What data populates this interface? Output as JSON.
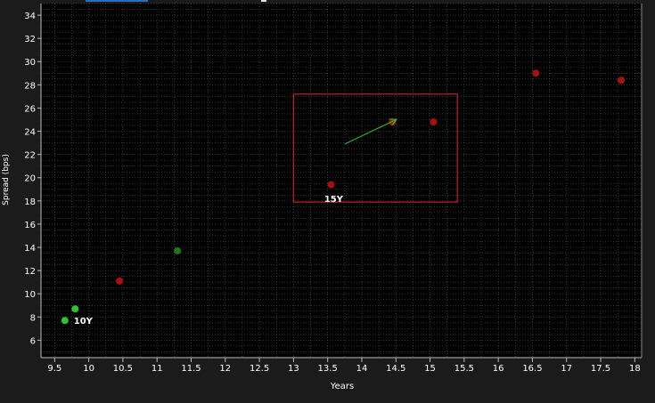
{
  "chart_data": {
    "type": "scatter",
    "title": "",
    "xlabel": "Years",
    "ylabel": "Spread (bps)",
    "xlim": [
      9.3,
      18.1
    ],
    "ylim": [
      4.5,
      35
    ],
    "x_ticks": [
      9.5,
      10,
      10.5,
      11,
      11.5,
      12,
      12.5,
      13,
      13.5,
      14,
      14.5,
      15,
      15.5,
      16,
      16.5,
      17,
      17.5,
      18
    ],
    "y_ticks": [
      6,
      8,
      10,
      12,
      14,
      16,
      18,
      20,
      22,
      24,
      26,
      28,
      30,
      32,
      34
    ],
    "grid": true,
    "legend": "none",
    "background_color": "#000000",
    "grid_color": "#555555",
    "series": [
      {
        "color": "#a81010",
        "points": [
          {
            "x": 10.45,
            "y": 11.1
          },
          {
            "x": 13.55,
            "y": 19.4
          },
          {
            "x": 14.45,
            "y": 24.8
          },
          {
            "x": 15.05,
            "y": 24.8
          },
          {
            "x": 16.55,
            "y": 29.0
          },
          {
            "x": 17.8,
            "y": 28.4
          }
        ]
      },
      {
        "color": "#1a7a1a",
        "points": [
          {
            "x": 11.3,
            "y": 13.7
          }
        ]
      },
      {
        "color": "#2ec42e",
        "points": [
          {
            "x": 9.65,
            "y": 7.7
          },
          {
            "x": 9.8,
            "y": 8.7
          }
        ]
      }
    ],
    "annotations": [
      {
        "text": "10Y",
        "x": 9.78,
        "y": 7.7
      },
      {
        "text": "15Y",
        "x": 13.45,
        "y": 18.2
      }
    ],
    "highlight_box": {
      "x0": 13.0,
      "x1": 15.4,
      "y0": 17.9,
      "y1": 27.2,
      "color": "#c0202a"
    },
    "arrow": {
      "from": {
        "x": 13.75,
        "y": 22.9
      },
      "to": {
        "x": 14.5,
        "y": 25.0
      },
      "color": "#2ec42e"
    }
  }
}
